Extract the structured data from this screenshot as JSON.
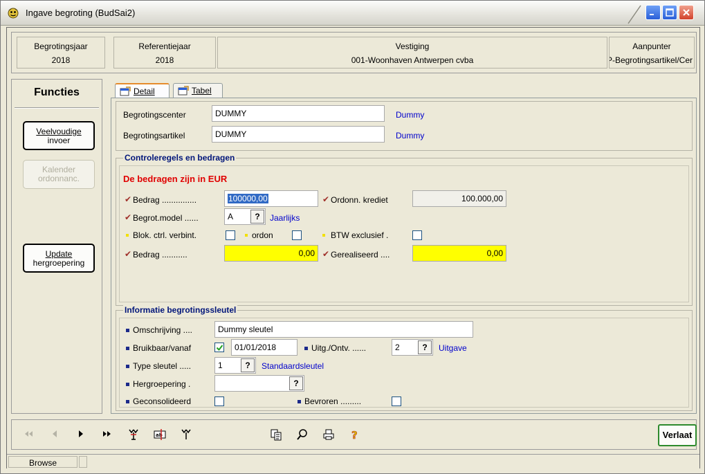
{
  "window": {
    "title": "Ingave begroting (BudSai2)",
    "icon": "app-face-icon"
  },
  "header": {
    "cells": [
      {
        "label": "Begrotingsjaar",
        "value": "2018"
      },
      {
        "label": "Referentiejaar",
        "value": "2018"
      },
      {
        "label": "Vestiging",
        "value": "001-Woonhaven Antwerpen cvba"
      },
      {
        "label": "Aanpunter",
        "value": "P-Begrotingsartikel/Cer"
      }
    ]
  },
  "functies": {
    "title": "Functies",
    "buttons": [
      {
        "line1": "Veelvoudige",
        "line2": "invoer",
        "enabled": true
      },
      {
        "line1": "Kalender",
        "line2": "ordonnanc.",
        "enabled": false
      },
      {
        "line1": "Update",
        "line2": "hergroepering",
        "enabled": true
      }
    ]
  },
  "tabs": [
    {
      "label": "Detail",
      "active": true
    },
    {
      "label": "Tabel",
      "active": false
    }
  ],
  "general": {
    "begrotingscenter_label": "Begrotingscenter",
    "begrotingscenter_value": "DUMMY",
    "begrotingscenter_desc": "Dummy",
    "begrotingsartikel_label": "Begrotingsartikel",
    "begrotingsartikel_value": "DUMMY",
    "begrotingsartikel_desc": "Dummy"
  },
  "controle": {
    "title": "Controleregels en bedragen",
    "currency_note": "De bedragen zijn in EUR",
    "bedrag_label": "Bedrag ...............",
    "bedrag_value": "100000,00",
    "ordonn_label": "Ordonn. krediet",
    "ordonn_value": "100.000,00",
    "begrotmodel_label": "Begrot.model ......",
    "begrotmodel_value": "A",
    "begrotmodel_desc": "Jaarlijks",
    "blok_label": "Blok. ctrl. verbint.",
    "ordon_label": "ordon",
    "btw_label": "BTW exclusief .",
    "bedrag2_label": "Bedrag ...........",
    "bedrag2_value": "0,00",
    "gerealiseerd_label": "Gerealiseerd ....",
    "gerealiseerd_value": "0,00"
  },
  "sleutel": {
    "title": "Informatie begrotingssleutel",
    "omschrijving_label": "Omschrijving ....",
    "omschrijving_value": "Dummy sleutel",
    "bruikbaar_label": "Bruikbaar/vanaf",
    "bruikbaar_checked": true,
    "bruikbaar_date": "01/01/2018",
    "uitg_label": "Uitg./Ontv. ......",
    "uitg_value": "2",
    "uitg_desc": "Uitgave",
    "type_label": "Type sleutel .....",
    "type_value": "1",
    "type_desc": "Standaardsleutel",
    "hergroepering_label": "Hergroepering .",
    "hergroepering_value": "",
    "geconsolideerd_label": "Geconsolideerd",
    "bevroren_label": "Bevroren ........."
  },
  "question_mark": "?",
  "toolbar": {
    "verlaat_label": "Verlaat"
  },
  "status": {
    "mode": "Browse"
  },
  "colors": {
    "title_blue": "#00157a",
    "link_blue": "#0000cc",
    "red": "#e00000",
    "highlight_yellow": "#ffff00"
  }
}
